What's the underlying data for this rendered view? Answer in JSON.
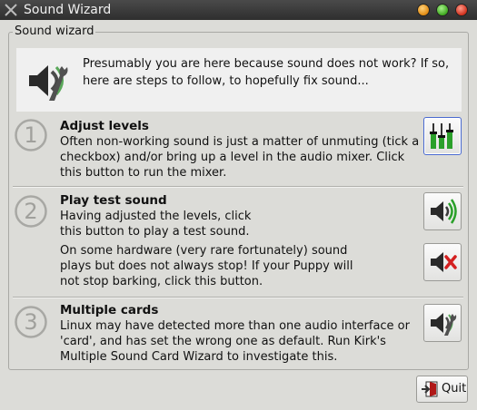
{
  "window": {
    "title": "Sound Wizard"
  },
  "frame": {
    "label": "Sound wizard"
  },
  "intro": {
    "text": "Presumably you are here because sound does not work? If so, here are steps to follow, to hopefully fix sound..."
  },
  "sections": [
    {
      "number": "1",
      "title": "Adjust levels",
      "text": "Often non-working sound is just a matter of unmuting (tick a checkbox) and/or bring up a level in the audio mixer. Click this button to run the mixer.",
      "button_icon": "mixer-icon"
    },
    {
      "number": "2",
      "title": "Play test sound",
      "text": "Having adjusted the levels, click this button to play a test sound.",
      "text2": "On some hardware (very rare fortunately) sound plays but does not always stop! If your Puppy will not stop barking, click this button.",
      "button_icon": "speaker-play-icon",
      "button2_icon": "speaker-mute-icon"
    },
    {
      "number": "3",
      "title": "Multiple cards",
      "text": "Linux may have detected more than one audio interface or 'card', and has set the wrong one as default. Run Kirk's Multiple Sound Card Wizard to investigate this.",
      "button_icon": "speaker-wrench-icon"
    }
  ],
  "quit": {
    "label": "Quit",
    "icon": "exit-icon"
  },
  "colors": {
    "titlebar": "#3a3a3a",
    "window_bg": "#dcdcd8",
    "intro_bg": "#f0f0f0",
    "mixer_green": "#2aa02a",
    "mute_red": "#d42020",
    "focus_border": "#4a6ad0"
  }
}
